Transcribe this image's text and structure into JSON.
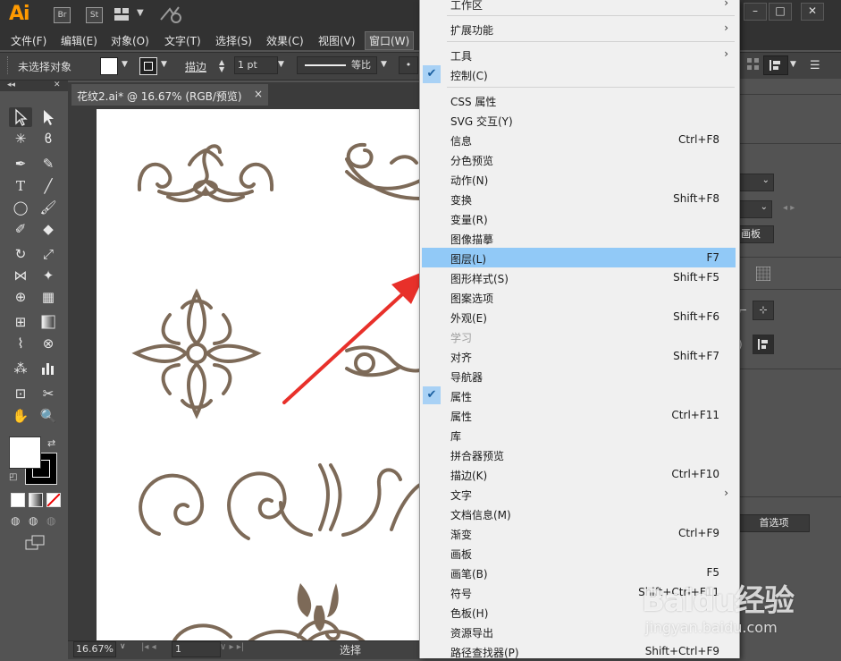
{
  "app": {
    "logo": "Ai",
    "icons": [
      "Br",
      "St"
    ]
  },
  "menubar": [
    {
      "label": "文件(F)"
    },
    {
      "label": "编辑(E)"
    },
    {
      "label": "对象(O)"
    },
    {
      "label": "文字(T)"
    },
    {
      "label": "选择(S)"
    },
    {
      "label": "效果(C)"
    },
    {
      "label": "视图(V)"
    },
    {
      "label": "窗口(W)"
    }
  ],
  "control": {
    "selection_label": "未选择对象",
    "stroke_label": "描边",
    "stroke_value": "1 pt",
    "profile_label": "等比"
  },
  "document": {
    "tab_title": "花纹2.ai* @ 16.67% (RGB/预览)",
    "close": "×"
  },
  "status": {
    "zoom": "16.67%",
    "page": "1",
    "mode": "选择"
  },
  "right_panel": {
    "artboard_label": "画板",
    "prefs_label": "首选项"
  },
  "window_menu": {
    "items": [
      {
        "label": "工作区",
        "submenu": true
      },
      {
        "label": "扩展功能",
        "submenu": true
      },
      {
        "label": "工具",
        "submenu": true
      },
      {
        "label": "控制(C)",
        "checked": true
      },
      {
        "label": "CSS 属性"
      },
      {
        "label": "SVG 交互(Y)"
      },
      {
        "label": "信息",
        "shortcut": "Ctrl+F8"
      },
      {
        "label": "分色预览"
      },
      {
        "label": "动作(N)"
      },
      {
        "label": "变换",
        "shortcut": "Shift+F8"
      },
      {
        "label": "变量(R)"
      },
      {
        "label": "图像描摹"
      },
      {
        "label": "图层(L)",
        "shortcut": "F7",
        "highlighted": true
      },
      {
        "label": "图形样式(S)",
        "shortcut": "Shift+F5"
      },
      {
        "label": "图案选项"
      },
      {
        "label": "外观(E)",
        "shortcut": "Shift+F6"
      },
      {
        "label": "学习",
        "disabled": true
      },
      {
        "label": "对齐",
        "shortcut": "Shift+F7"
      },
      {
        "label": "导航器"
      },
      {
        "label": "属性",
        "checked": true
      },
      {
        "label": "属性",
        "shortcut": "Ctrl+F11"
      },
      {
        "label": "库"
      },
      {
        "label": "拼合器预览"
      },
      {
        "label": "描边(K)",
        "shortcut": "Ctrl+F10"
      },
      {
        "label": "文字",
        "submenu": true
      },
      {
        "label": "文档信息(M)"
      },
      {
        "label": "渐变",
        "shortcut": "Ctrl+F9"
      },
      {
        "label": "画板"
      },
      {
        "label": "画笔(B)",
        "shortcut": "F5"
      },
      {
        "label": "符号",
        "shortcut": "Shift+Ctrl+F11"
      },
      {
        "label": "色板(H)"
      },
      {
        "label": "资源导出"
      },
      {
        "label": "路径查找器(P)",
        "shortcut": "Shift+Ctrl+F9"
      }
    ]
  },
  "watermark": {
    "brand": "Baidu经验",
    "url": "jingyan.baidu.com"
  },
  "colors": {
    "ornament": "#7d6a58",
    "highlight": "#91c9f7",
    "arrow": "#e8302a"
  }
}
